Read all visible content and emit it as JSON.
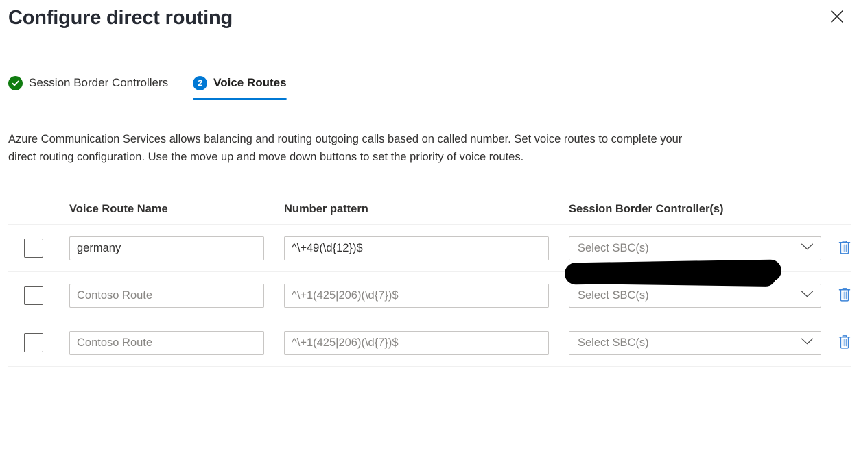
{
  "panel": {
    "title": "Configure direct routing",
    "close_label": "Close",
    "close_icon": "close-icon"
  },
  "tabs": [
    {
      "label": "Session Border Controllers",
      "state": "completed",
      "icon": "check-circle-icon",
      "badge": "",
      "active": false
    },
    {
      "label": "Voice Routes",
      "state": "current",
      "icon": "step-number-icon",
      "badge": "2",
      "active": true
    }
  ],
  "description": "Azure Communication Services allows balancing and routing outgoing calls based on called number. Set voice routes to complete your direct routing configuration. Use the move up and move down buttons to set the priority of voice routes.",
  "table": {
    "headers": {
      "select": "",
      "name": "Voice Route Name",
      "pattern": "Number pattern",
      "sbc": "Session Border Controller(s)"
    },
    "rows": [
      {
        "selected": false,
        "name_value": "germany",
        "name_placeholder": "Contoso Route",
        "pattern_value": "^\\+49(\\d{12})$",
        "pattern_placeholder": "^\\+1(425|206)(\\d{7})$",
        "sbc_value": "",
        "sbc_placeholder": "Select SBC(s)",
        "sbc_redacted": true,
        "delete_label": "Delete voice route"
      },
      {
        "selected": false,
        "name_value": "",
        "name_placeholder": "Contoso Route",
        "pattern_value": "",
        "pattern_placeholder": "^\\+1(425|206)(\\d{7})$",
        "sbc_value": "",
        "sbc_placeholder": "Select SBC(s)",
        "sbc_redacted": false,
        "delete_label": "Delete voice route"
      },
      {
        "selected": false,
        "name_value": "",
        "name_placeholder": "Contoso Route",
        "pattern_value": "",
        "pattern_placeholder": "^\\+1(425|206)(\\d{7})$",
        "sbc_value": "",
        "sbc_placeholder": "Select SBC(s)",
        "sbc_redacted": false,
        "delete_label": "Delete voice route"
      }
    ]
  },
  "icons": {
    "chevron": "chevron-down-icon",
    "delete": "trash-icon",
    "checkbox": "checkbox-icon"
  },
  "colors": {
    "accent": "#0078d4",
    "success": "#107c10",
    "text": "#323130",
    "placeholder": "#888683",
    "border": "#c8c6c4",
    "divider": "#f0f0f0",
    "redaction": "#000000"
  }
}
